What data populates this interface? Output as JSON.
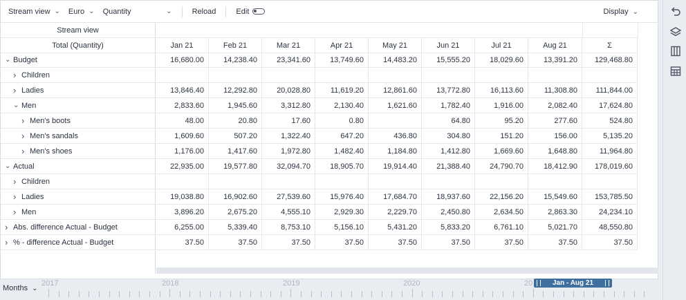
{
  "toolbar": {
    "view": "Stream view",
    "currency": "Euro",
    "measure": "Quantity",
    "reload": "Reload",
    "edit": "Edit",
    "display": "Display"
  },
  "grid": {
    "header_top": "Stream view",
    "header_label": "Total (Quantity)",
    "columns": [
      "Jan 21",
      "Feb 21",
      "Mar 21",
      "Apr 21",
      "May 21",
      "Jun 21",
      "Jul 21",
      "Aug 21",
      "Σ"
    ],
    "rows": [
      {
        "label": "Budget",
        "expanded": true,
        "level": 0,
        "values": [
          "16,680.00",
          "14,238.40",
          "23,341.60",
          "13,749.60",
          "14,483.20",
          "15,555.20",
          "18,029.60",
          "13,391.20",
          "129,468.80"
        ]
      },
      {
        "label": "Children",
        "expanded": false,
        "level": 1,
        "values": [
          "",
          "",
          "",
          "",
          "",
          "",
          "",
          "",
          ""
        ]
      },
      {
        "label": "Ladies",
        "expanded": false,
        "level": 1,
        "values": [
          "13,846.40",
          "12,292.80",
          "20,028.80",
          "11,619.20",
          "12,861.60",
          "13,772.80",
          "16,113.60",
          "11,308.80",
          "111,844.00"
        ]
      },
      {
        "label": "Men",
        "expanded": true,
        "level": 1,
        "values": [
          "2,833.60",
          "1,945.60",
          "3,312.80",
          "2,130.40",
          "1,621.60",
          "1,782.40",
          "1,916.00",
          "2,082.40",
          "17,624.80"
        ]
      },
      {
        "label": "Men's boots",
        "expanded": false,
        "level": 2,
        "values": [
          "48.00",
          "20.80",
          "17.60",
          "0.80",
          "",
          "64.80",
          "95.20",
          "277.60",
          "524.80"
        ]
      },
      {
        "label": "Men's sandals",
        "expanded": false,
        "level": 2,
        "values": [
          "1,609.60",
          "507.20",
          "1,322.40",
          "647.20",
          "436.80",
          "304.80",
          "151.20",
          "156.00",
          "5,135.20"
        ]
      },
      {
        "label": "Men's shoes",
        "expanded": false,
        "level": 2,
        "values": [
          "1,176.00",
          "1,417.60",
          "1,972.80",
          "1,482.40",
          "1,184.80",
          "1,412.80",
          "1,669.60",
          "1,648.80",
          "11,964.80"
        ]
      },
      {
        "label": "Actual",
        "expanded": true,
        "level": 0,
        "values": [
          "22,935.00",
          "19,577.80",
          "32,094.70",
          "18,905.70",
          "19,914.40",
          "21,388.40",
          "24,790.70",
          "18,412.90",
          "178,019.60"
        ]
      },
      {
        "label": "Children",
        "expanded": false,
        "level": 1,
        "values": [
          "",
          "",
          "",
          "",
          "",
          "",
          "",
          "",
          ""
        ]
      },
      {
        "label": "Ladies",
        "expanded": false,
        "level": 1,
        "values": [
          "19,038.80",
          "16,902.60",
          "27,539.60",
          "15,976.40",
          "17,684.70",
          "18,937.60",
          "22,156.20",
          "15,549.60",
          "153,785.50"
        ]
      },
      {
        "label": "Men",
        "expanded": false,
        "level": 1,
        "values": [
          "3,896.20",
          "2,675.20",
          "4,555.10",
          "2,929.30",
          "2,229.70",
          "2,450.80",
          "2,634.50",
          "2,863.30",
          "24,234.10"
        ]
      },
      {
        "label": "Abs. difference Actual - Budget",
        "expanded": false,
        "level": 0,
        "values": [
          "6,255.00",
          "5,339.40",
          "8,753.10",
          "5,156.10",
          "5,431.20",
          "5,833.20",
          "6,761.10",
          "5,021.70",
          "48,550.80"
        ]
      },
      {
        "label": "% - difference Actual - Budget",
        "expanded": false,
        "level": 0,
        "values": [
          "37.50",
          "37.50",
          "37.50",
          "37.50",
          "37.50",
          "37.50",
          "37.50",
          "37.50",
          "37.50"
        ]
      }
    ]
  },
  "timeline": {
    "granularity": "Months",
    "years": [
      "2017",
      "2018",
      "2019",
      "2020",
      "20"
    ],
    "range_label": "Jan - Aug 21"
  },
  "sidebar_icons": [
    "undo-icon",
    "layers-icon",
    "book-icon",
    "table-icon"
  ]
}
